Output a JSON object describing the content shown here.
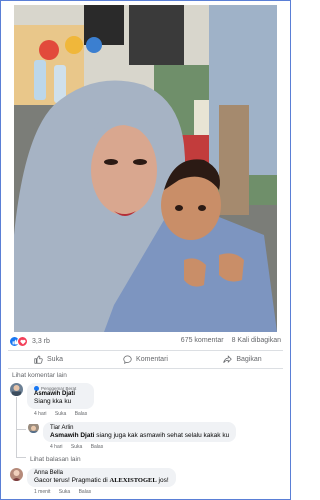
{
  "post": {
    "reaction_count": "3,3 rb",
    "comment_count": "675 komentar",
    "share_count": "8 Kali dibagikan",
    "colors": {
      "like": "#1877f2",
      "love": "#f33e58",
      "photo_bg": "#8d8f8b"
    }
  },
  "actions": {
    "like_label": "Suka",
    "comment_label": "Komentari",
    "share_label": "Bagikan"
  },
  "more_comments_label": "Lihat komentar lain",
  "comments": [
    {
      "badge": "Penggemar Berat",
      "author": "Asmawih Djati",
      "text": "Siang kka ku",
      "time": "4 hari",
      "like": "Suka",
      "reply": "Balas"
    },
    {
      "author": "Tiar Arlin",
      "text": "Asmawih Djati siang juga kak asmawih sehat selalu kakak ku",
      "text_name": "Asmawih Djati",
      "text_rest": " siang juga kak asmawih sehat selalu kakak ku",
      "time": "4 hari",
      "like": "Suka",
      "reply": "Balas"
    }
  ],
  "more_replies_label": "Lihat balasan lain",
  "spam_comment": {
    "author": "Anna Bella",
    "text_prefix": "Gacor terus! Pragmatic di ",
    "text_brand": "ALEXISTOGEL",
    "text_suffix": " jos!",
    "time": "1 menit",
    "like": "Suka",
    "reply": "Balas"
  }
}
